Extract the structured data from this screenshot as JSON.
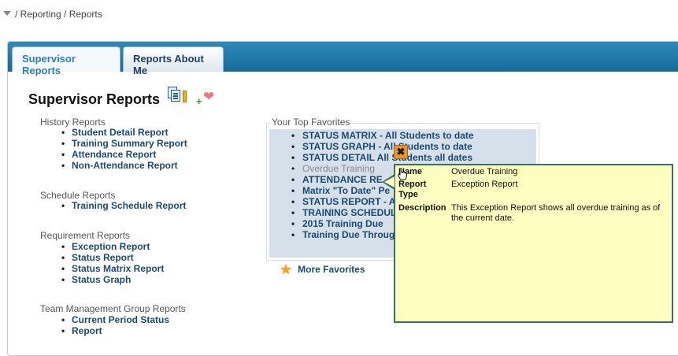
{
  "breadcrumb": {
    "text": "/ Reporting / Reports"
  },
  "tabs": [
    {
      "label": "Supervisor Reports",
      "active": true
    },
    {
      "label": "Reports About Me",
      "active": false
    }
  ],
  "page": {
    "title": "Supervisor Reports"
  },
  "sections": [
    {
      "heading": "History Reports",
      "items": [
        "Student Detail Report",
        "Training Summary Report",
        "Attendance Report",
        "Non-Attendance Report"
      ]
    },
    {
      "heading": "Schedule Reports",
      "items": [
        "Training Schedule Report"
      ]
    },
    {
      "heading": "Requirement Reports",
      "items": [
        "Exception Report",
        "Status Report",
        "Status Matrix Report",
        "Status Graph"
      ]
    },
    {
      "heading": "Team Management Group Reports",
      "items": [
        "Current Period Status",
        "Report"
      ]
    }
  ],
  "favorites": {
    "heading": "Your Top Favorites",
    "items": [
      "STATUS MATRIX - All Students to date",
      "STATUS GRAPH - All Students to date",
      "STATUS DETAIL All Students all dates",
      "Overdue Training",
      "ATTENDANCE RE",
      "Matrix \"To Date\" Pe",
      "STATUS REPORT - A",
      "TRAINING SCHEDUL",
      "2015 Training Due",
      "Training Due Throug"
    ],
    "more_label": "More Favorites"
  },
  "tooltip": {
    "name_key": "Name",
    "name_value": "Overdue Training",
    "type_key_1": "Report",
    "type_key_2": "Type",
    "type_value": "Exception Report",
    "desc_key": "Description",
    "desc_value": "This Exception Report shows all overdue training as of the current date."
  },
  "icons": {
    "report_docs": "documents-key-icon",
    "add_favorite": "add-favorite-heart-icon",
    "more_favorites": "star-icon",
    "close": "close-icon",
    "cursor": "hand-pointer-icon"
  },
  "colors": {
    "tab_bar": "#1a74a3",
    "link": "#1b4a6e",
    "favorites_bg": "#d5e0ea",
    "tooltip_bg": "#fdfec0",
    "tooltip_border": "#3e6d63",
    "close_button": "#e8962a"
  }
}
